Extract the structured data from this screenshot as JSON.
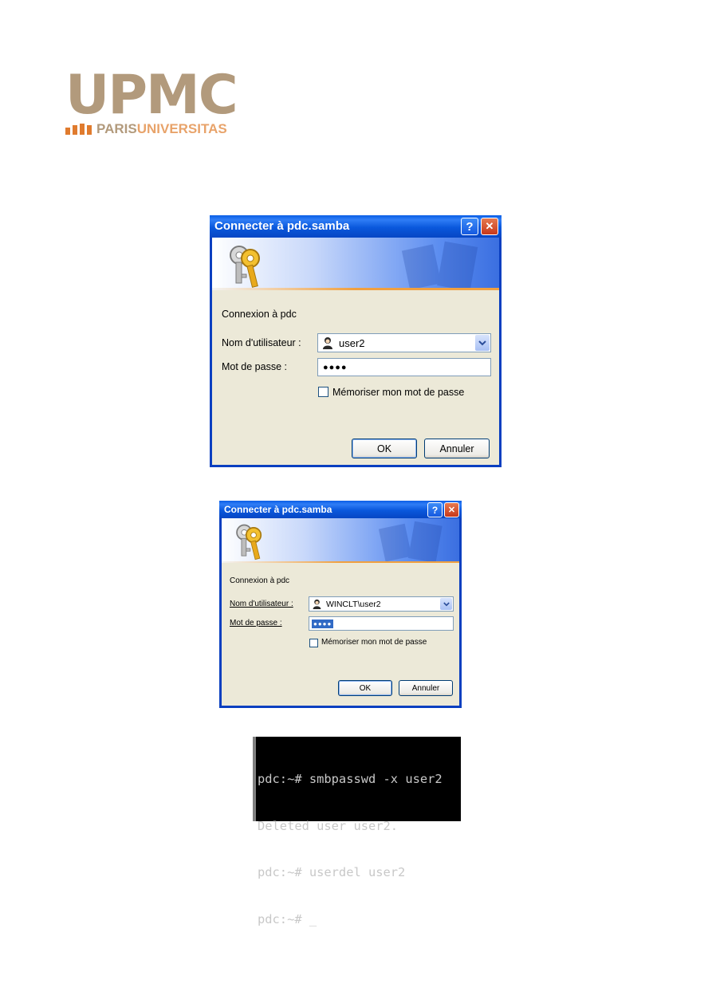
{
  "logo": {
    "word": "UPMC",
    "part1": "PARIS",
    "part2": "UNIVERSITAS"
  },
  "dialog1": {
    "title": "Connecter à pdc.samba",
    "help_glyph": "?",
    "close_glyph": "✕",
    "connect_to": "Connexion à pdc",
    "username_label": "Nom d'utilisateur :",
    "username_value": "user2",
    "password_label": "Mot de passe :",
    "password_mask": "●●●●",
    "remember_label": "Mémoriser mon mot de passe",
    "ok_label": "OK",
    "cancel_label": "Annuler"
  },
  "dialog2": {
    "title": "Connecter à pdc.samba",
    "help_glyph": "?",
    "close_glyph": "✕",
    "connect_to": "Connexion à pdc",
    "username_label": "Nom d'utilisateur :",
    "username_value": "WINCLT\\user2",
    "password_label": "Mot de passe :",
    "password_mask": "●●●●",
    "remember_label": "Mémoriser mon mot de passe",
    "ok_label": "OK",
    "cancel_label": "Annuler"
  },
  "terminal": {
    "lines": [
      "pdc:~# smbpasswd -x user2",
      "Deleted user user2.",
      "pdc:~# userdel user2",
      "pdc:~# _"
    ]
  },
  "colors": {
    "titlebar": "#0a58dc",
    "dialog_bg": "#ece9d8",
    "logo_taupe": "#b29a7c",
    "logo_orange": "#e07b2e"
  }
}
